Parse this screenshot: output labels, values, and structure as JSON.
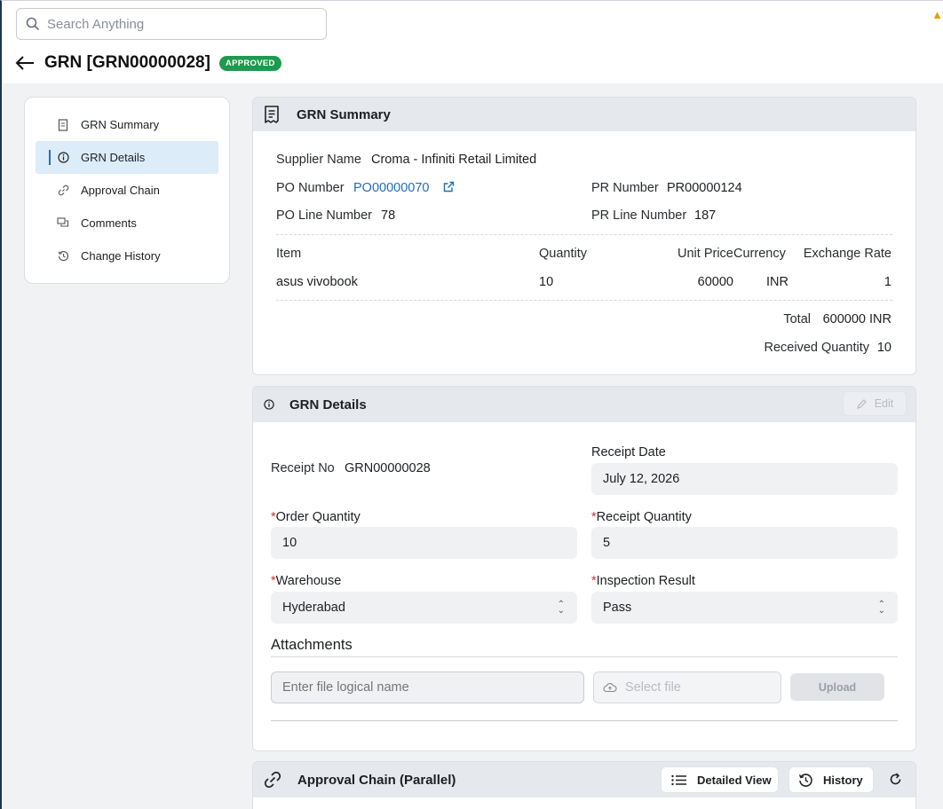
{
  "search": {
    "placeholder": "Search Anything"
  },
  "page": {
    "title": "GRN [GRN00000028]",
    "status": "APPROVED"
  },
  "sidebar": {
    "items": [
      {
        "label": "GRN Summary",
        "icon": "receipt-icon"
      },
      {
        "label": "GRN Details",
        "icon": "info-icon",
        "active": true
      },
      {
        "label": "Approval Chain",
        "icon": "link-icon"
      },
      {
        "label": "Comments",
        "icon": "comments-icon"
      },
      {
        "label": "Change History",
        "icon": "history-icon"
      }
    ]
  },
  "summary": {
    "title": "GRN Summary",
    "supplier_label": "Supplier Name",
    "supplier_value": "Croma - Infiniti Retail Limited",
    "po_label": "PO Number",
    "po_value": "PO00000070",
    "pr_label": "PR Number",
    "pr_value": "PR00000124",
    "po_line_label": "PO Line Number",
    "po_line_value": "78",
    "pr_line_label": "PR Line Number",
    "pr_line_value": "187",
    "table": {
      "headers": [
        "Item",
        "Quantity",
        "Unit Price",
        "Currency",
        "Exchange Rate"
      ],
      "row": [
        "asus vivobook",
        "10",
        "60000",
        "INR",
        "1"
      ]
    },
    "total_label": "Total",
    "total_value": "600000 INR",
    "received_label": "Received Quantity",
    "received_value": "10"
  },
  "details": {
    "title": "GRN Details",
    "edit_label": "Edit",
    "receipt_no_label": "Receipt No",
    "receipt_no_value": "GRN00000028",
    "receipt_date_label": "Receipt Date",
    "receipt_date_value": "July 12, 2026",
    "order_qty_label": "Order Quantity",
    "order_qty_value": "10",
    "receipt_qty_label": "Receipt Quantity",
    "receipt_qty_value": "5",
    "warehouse_label": "Warehouse",
    "warehouse_value": "Hyderabad",
    "inspection_label": "Inspection Result",
    "inspection_value": "Pass",
    "attachments_label": "Attachments",
    "file_name_placeholder": "Enter file logical name",
    "select_file_label": "Select file",
    "upload_label": "Upload",
    "required_mark": "*"
  },
  "approval": {
    "title": "Approval Chain (Parallel)",
    "detailed_view_label": "Detailed View",
    "history_label": "History"
  },
  "colors": {
    "accent": "#1f6fb2",
    "approved": "#1d9a4e",
    "required": "#d32f2f"
  }
}
